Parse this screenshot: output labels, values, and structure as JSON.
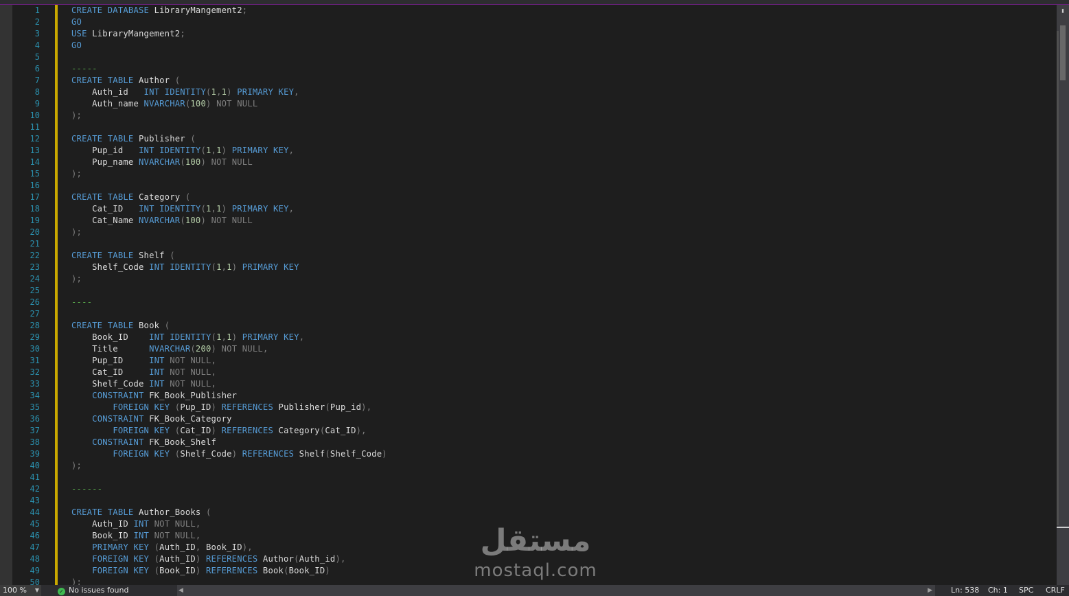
{
  "editor": {
    "lines": [
      [
        [
          "kw",
          "CREATE DATABASE"
        ],
        [
          "id",
          " LibraryMangement2"
        ],
        [
          "pu",
          ";"
        ]
      ],
      [
        [
          "kw",
          "GO"
        ]
      ],
      [
        [
          "kw",
          "USE"
        ],
        [
          "id",
          " LibraryMangement2"
        ],
        [
          "pu",
          ";"
        ]
      ],
      [
        [
          "kw",
          "GO"
        ]
      ],
      [],
      [
        [
          "cm",
          "-----"
        ]
      ],
      [
        [
          "kw",
          "CREATE TABLE"
        ],
        [
          "id",
          " Author "
        ],
        [
          "pu",
          "("
        ]
      ],
      [
        [
          "id",
          "    Auth_id   "
        ],
        [
          "kw",
          "INT IDENTITY"
        ],
        [
          "pu",
          "("
        ],
        [
          "nu",
          "1"
        ],
        [
          "pu",
          ","
        ],
        [
          "nu",
          "1"
        ],
        [
          "pu",
          ") "
        ],
        [
          "kw",
          "PRIMARY KEY"
        ],
        [
          "pu",
          ","
        ]
      ],
      [
        [
          "id",
          "    Auth_name "
        ],
        [
          "kw",
          "NVARCHAR"
        ],
        [
          "pu",
          "("
        ],
        [
          "nu",
          "100"
        ],
        [
          "pu",
          ") "
        ],
        [
          "gr",
          "NOT NULL"
        ]
      ],
      [
        [
          "pu",
          ");"
        ]
      ],
      [],
      [
        [
          "kw",
          "CREATE TABLE"
        ],
        [
          "id",
          " Publisher "
        ],
        [
          "pu",
          "("
        ]
      ],
      [
        [
          "id",
          "    Pup_id   "
        ],
        [
          "kw",
          "INT IDENTITY"
        ],
        [
          "pu",
          "("
        ],
        [
          "nu",
          "1"
        ],
        [
          "pu",
          ","
        ],
        [
          "nu",
          "1"
        ],
        [
          "pu",
          ") "
        ],
        [
          "kw",
          "PRIMARY KEY"
        ],
        [
          "pu",
          ","
        ]
      ],
      [
        [
          "id",
          "    Pup_name "
        ],
        [
          "kw",
          "NVARCHAR"
        ],
        [
          "pu",
          "("
        ],
        [
          "nu",
          "100"
        ],
        [
          "pu",
          ") "
        ],
        [
          "gr",
          "NOT NULL"
        ]
      ],
      [
        [
          "pu",
          ");"
        ]
      ],
      [],
      [
        [
          "kw",
          "CREATE TABLE"
        ],
        [
          "id",
          " Category "
        ],
        [
          "pu",
          "("
        ]
      ],
      [
        [
          "id",
          "    Cat_ID   "
        ],
        [
          "kw",
          "INT IDENTITY"
        ],
        [
          "pu",
          "("
        ],
        [
          "nu",
          "1"
        ],
        [
          "pu",
          ","
        ],
        [
          "nu",
          "1"
        ],
        [
          "pu",
          ") "
        ],
        [
          "kw",
          "PRIMARY KEY"
        ],
        [
          "pu",
          ","
        ]
      ],
      [
        [
          "id",
          "    Cat_Name "
        ],
        [
          "kw",
          "NVARCHAR"
        ],
        [
          "pu",
          "("
        ],
        [
          "nu",
          "100"
        ],
        [
          "pu",
          ") "
        ],
        [
          "gr",
          "NOT NULL"
        ]
      ],
      [
        [
          "pu",
          ");"
        ]
      ],
      [],
      [
        [
          "kw",
          "CREATE TABLE"
        ],
        [
          "id",
          " Shelf "
        ],
        [
          "pu",
          "("
        ]
      ],
      [
        [
          "id",
          "    Shelf_Code "
        ],
        [
          "kw",
          "INT IDENTITY"
        ],
        [
          "pu",
          "("
        ],
        [
          "nu",
          "1"
        ],
        [
          "pu",
          ","
        ],
        [
          "nu",
          "1"
        ],
        [
          "pu",
          ") "
        ],
        [
          "kw",
          "PRIMARY KEY"
        ]
      ],
      [
        [
          "pu",
          ");"
        ]
      ],
      [],
      [
        [
          "cm",
          "----"
        ]
      ],
      [],
      [
        [
          "kw",
          "CREATE TABLE"
        ],
        [
          "id",
          " Book "
        ],
        [
          "pu",
          "("
        ]
      ],
      [
        [
          "id",
          "    Book_ID    "
        ],
        [
          "kw",
          "INT IDENTITY"
        ],
        [
          "pu",
          "("
        ],
        [
          "nu",
          "1"
        ],
        [
          "pu",
          ","
        ],
        [
          "nu",
          "1"
        ],
        [
          "pu",
          ") "
        ],
        [
          "kw",
          "PRIMARY KEY"
        ],
        [
          "pu",
          ","
        ]
      ],
      [
        [
          "id",
          "    Title      "
        ],
        [
          "kw",
          "NVARCHAR"
        ],
        [
          "pu",
          "("
        ],
        [
          "nu",
          "200"
        ],
        [
          "pu",
          ") "
        ],
        [
          "gr",
          "NOT NULL"
        ],
        [
          "pu",
          ","
        ]
      ],
      [
        [
          "id",
          "    Pup_ID     "
        ],
        [
          "kw",
          "INT"
        ],
        [
          "gr",
          " NOT NULL"
        ],
        [
          "pu",
          ","
        ]
      ],
      [
        [
          "id",
          "    Cat_ID     "
        ],
        [
          "kw",
          "INT"
        ],
        [
          "gr",
          " NOT NULL"
        ],
        [
          "pu",
          ","
        ]
      ],
      [
        [
          "id",
          "    Shelf_Code "
        ],
        [
          "kw",
          "INT"
        ],
        [
          "gr",
          " NOT NULL"
        ],
        [
          "pu",
          ","
        ]
      ],
      [
        [
          "id",
          "    "
        ],
        [
          "kw",
          "CONSTRAINT"
        ],
        [
          "id",
          " FK_Book_Publisher"
        ]
      ],
      [
        [
          "id",
          "        "
        ],
        [
          "kw",
          "FOREIGN KEY"
        ],
        [
          "pu",
          " ("
        ],
        [
          "id",
          "Pup_ID"
        ],
        [
          "pu",
          ") "
        ],
        [
          "kw",
          "REFERENCES"
        ],
        [
          "id",
          " Publisher"
        ],
        [
          "pu",
          "("
        ],
        [
          "id",
          "Pup_id"
        ],
        [
          "pu",
          "),"
        ]
      ],
      [
        [
          "id",
          "    "
        ],
        [
          "kw",
          "CONSTRAINT"
        ],
        [
          "id",
          " FK_Book_Category"
        ]
      ],
      [
        [
          "id",
          "        "
        ],
        [
          "kw",
          "FOREIGN KEY"
        ],
        [
          "pu",
          " ("
        ],
        [
          "id",
          "Cat_ID"
        ],
        [
          "pu",
          ") "
        ],
        [
          "kw",
          "REFERENCES"
        ],
        [
          "id",
          " Category"
        ],
        [
          "pu",
          "("
        ],
        [
          "id",
          "Cat_ID"
        ],
        [
          "pu",
          "),"
        ]
      ],
      [
        [
          "id",
          "    "
        ],
        [
          "kw",
          "CONSTRAINT"
        ],
        [
          "id",
          " FK_Book_Shelf"
        ]
      ],
      [
        [
          "id",
          "        "
        ],
        [
          "kw",
          "FOREIGN KEY"
        ],
        [
          "pu",
          " ("
        ],
        [
          "id",
          "Shelf_Code"
        ],
        [
          "pu",
          ") "
        ],
        [
          "kw",
          "REFERENCES"
        ],
        [
          "id",
          " Shelf"
        ],
        [
          "pu",
          "("
        ],
        [
          "id",
          "Shelf_Code"
        ],
        [
          "pu",
          ")"
        ]
      ],
      [
        [
          "pu",
          ");"
        ]
      ],
      [],
      [
        [
          "cm",
          "------"
        ]
      ],
      [],
      [
        [
          "kw",
          "CREATE TABLE"
        ],
        [
          "id",
          " Author_Books "
        ],
        [
          "pu",
          "("
        ]
      ],
      [
        [
          "id",
          "    Auth_ID "
        ],
        [
          "kw",
          "INT"
        ],
        [
          "gr",
          " NOT NULL"
        ],
        [
          "pu",
          ","
        ]
      ],
      [
        [
          "id",
          "    Book_ID "
        ],
        [
          "kw",
          "INT"
        ],
        [
          "gr",
          " NOT NULL"
        ],
        [
          "pu",
          ","
        ]
      ],
      [
        [
          "id",
          "    "
        ],
        [
          "kw",
          "PRIMARY KEY"
        ],
        [
          "pu",
          " ("
        ],
        [
          "id",
          "Auth_ID"
        ],
        [
          "pu",
          ", "
        ],
        [
          "id",
          "Book_ID"
        ],
        [
          "pu",
          "),"
        ]
      ],
      [
        [
          "id",
          "    "
        ],
        [
          "kw",
          "FOREIGN KEY"
        ],
        [
          "pu",
          " ("
        ],
        [
          "id",
          "Auth_ID"
        ],
        [
          "pu",
          ") "
        ],
        [
          "kw",
          "REFERENCES"
        ],
        [
          "id",
          " Author"
        ],
        [
          "pu",
          "("
        ],
        [
          "id",
          "Auth_id"
        ],
        [
          "pu",
          "),"
        ]
      ],
      [
        [
          "id",
          "    "
        ],
        [
          "kw",
          "FOREIGN KEY"
        ],
        [
          "pu",
          " ("
        ],
        [
          "id",
          "Book_ID"
        ],
        [
          "pu",
          ") "
        ],
        [
          "kw",
          "REFERENCES"
        ],
        [
          "id",
          " Book"
        ],
        [
          "pu",
          "("
        ],
        [
          "id",
          "Book_ID"
        ],
        [
          "pu",
          ")"
        ]
      ],
      [
        [
          "pu",
          ");"
        ]
      ]
    ],
    "first_line_number": 1
  },
  "statusbar": {
    "zoom": "100 %",
    "issues": "No issues found",
    "line": "Ln: 538",
    "char": "Ch: 1",
    "indent": "SPC",
    "line_ending": "CRLF"
  },
  "watermark": {
    "arabic": "مستقل",
    "latin": "mostaql.com"
  },
  "icons": {
    "split": "split-window-icon",
    "issues": "check-circle-icon",
    "zoom_dropdown": "chevron-down-icon"
  },
  "colors": {
    "keyword": "#569cd6",
    "identifier": "#dcdcdc",
    "gray": "#808080",
    "number": "#b5cea8",
    "comment": "#57a64a",
    "line_number": "#2b91af",
    "change_bar": "#c9a800"
  }
}
